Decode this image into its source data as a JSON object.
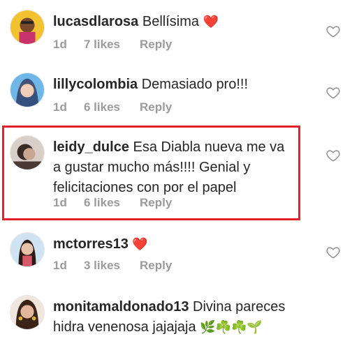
{
  "comments": [
    {
      "username": "lucasdlarosa",
      "text": "Bellísima",
      "emoji": "❤️",
      "age": "1d",
      "likes": "7 likes",
      "reply": "Reply"
    },
    {
      "username": "lillycolombia",
      "text": "Demasiado pro!!!",
      "emoji": "",
      "age": "1d",
      "likes": "6 likes",
      "reply": "Reply"
    },
    {
      "username": "leidy_dulce",
      "text": "Esa Diabla nueva me va a gustar mucho más!!!! Genial y felicitaciones con por el papel",
      "emoji": "",
      "age": "1d",
      "likes": "6 likes",
      "reply": "Reply"
    },
    {
      "username": "mctorres13",
      "text": "",
      "emoji": "❤️",
      "age": "1d",
      "likes": "3 likes",
      "reply": "Reply"
    },
    {
      "username": "monitamaldonado13",
      "text": "Divina pareces hidra venenosa jajajaja",
      "emoji": "🌿☘️☘️🌱",
      "age": "",
      "likes": "",
      "reply": ""
    }
  ],
  "icons": {
    "like": "heart-outline-icon"
  },
  "colors": {
    "highlight": "#e4202a",
    "meta_text": "#9b9b9b",
    "heart": "#e0262a"
  }
}
